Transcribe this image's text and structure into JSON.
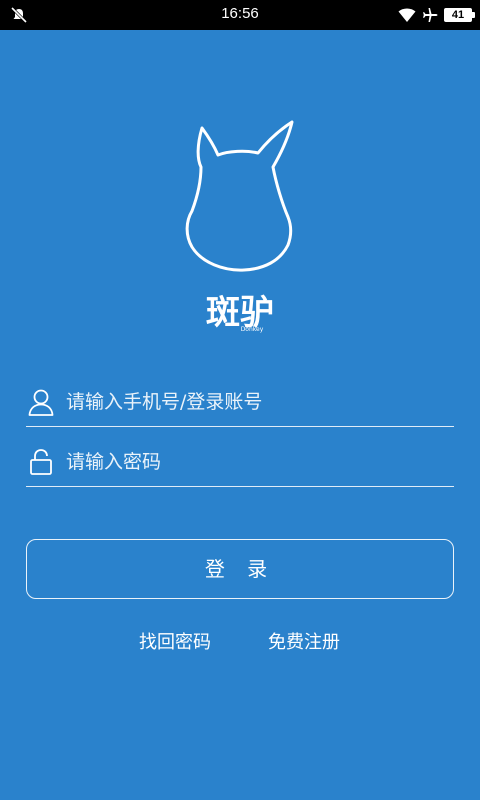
{
  "status_bar": {
    "time": "16:56",
    "battery": "41",
    "icons": [
      "notifications-off-icon",
      "wifi-icon",
      "airplane-icon",
      "battery-icon"
    ]
  },
  "brand": {
    "logo_icon": "donkey-head-logo-icon",
    "name": "斑驴",
    "sub": "Donkey"
  },
  "login": {
    "account_placeholder": "请输入手机号/登录账号",
    "password_placeholder": "请输入密码",
    "login_label": "登 录",
    "forgot_label": "找回密码",
    "register_label": "免费注册"
  },
  "colors": {
    "background": "#2a82cc",
    "foreground": "#ffffff",
    "status_bar": "#000000"
  }
}
